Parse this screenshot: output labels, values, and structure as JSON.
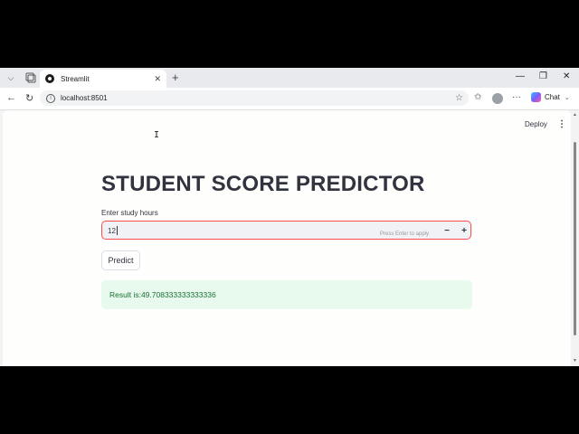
{
  "browser": {
    "tab_title": "Streamlit",
    "url": "localhost:8501",
    "chat_label": "Chat",
    "icons": {
      "tab_menu": "chevron-down-icon",
      "new_tab": "plus-icon",
      "back": "arrow-left-icon",
      "reload": "reload-icon",
      "favorite": "star-icon",
      "extensions": "more-icon"
    }
  },
  "app": {
    "deploy_label": "Deploy",
    "title": "STUDENT SCORE PREDICTOR",
    "input": {
      "label": "Enter study hours",
      "value": "12",
      "hint": "Press Enter to apply",
      "minus": "−",
      "plus": "+"
    },
    "predict_label": "Predict",
    "result": "Result is:49.708333333333336"
  },
  "colors": {
    "accent": "#ff4b4b",
    "result_bg": "#e8f9ee",
    "result_text": "#177233",
    "text": "#31333f"
  }
}
